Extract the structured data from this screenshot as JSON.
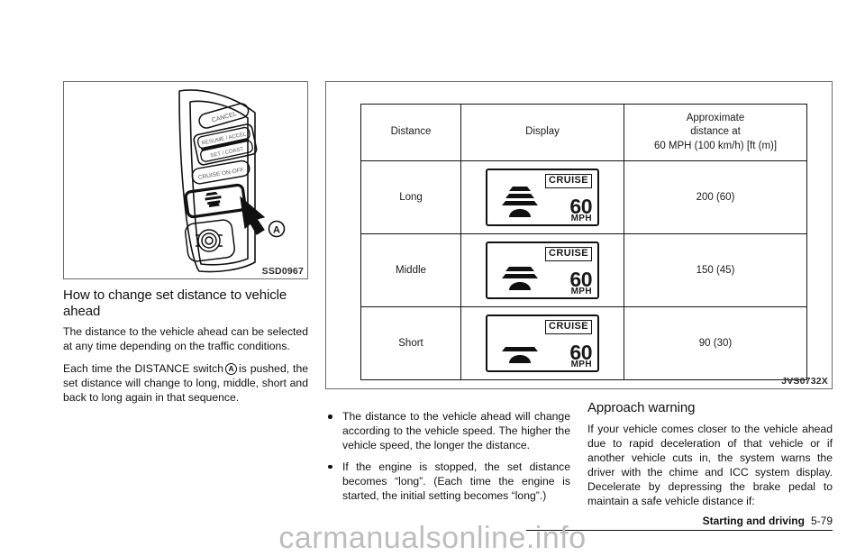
{
  "figure_left": {
    "caption": "SSD0967",
    "callout_label": "A",
    "switch_labels": [
      "CANCEL",
      "RESUME / ACCEL",
      "SET / COAST",
      "CRUISE ON-OFF"
    ]
  },
  "figure_right": {
    "caption": "JVS0732X",
    "table": {
      "headers": {
        "col1": "Distance",
        "col2": "Display",
        "col3_line1": "Approximate",
        "col3_line2": "distance at",
        "col3_line3": "60 MPH (100 km/h) [ft (m)]"
      },
      "rows": [
        {
          "distance": "Long",
          "bars": 3,
          "cruise": "CRUISE",
          "speed": "60",
          "unit": "MPH",
          "approx": "200 (60)"
        },
        {
          "distance": "Middle",
          "bars": 2,
          "cruise": "CRUISE",
          "speed": "60",
          "unit": "MPH",
          "approx": "150 (45)"
        },
        {
          "distance": "Short",
          "bars": 1,
          "cruise": "CRUISE",
          "speed": "60",
          "unit": "MPH",
          "approx": "90 (30)"
        }
      ]
    }
  },
  "section": {
    "heading": "How to change set distance to vehicle ahead",
    "para1": "The distance to the vehicle ahead can be selected at any time depending on the traffic conditions.",
    "para2_before": "Each time the DISTANCE switch",
    "para2_marker": "A",
    "para2_after": "is pushed, the set distance will change to long, middle, short and back to long again in that sequence."
  },
  "bullets": [
    "The distance to the vehicle ahead will change according to the vehicle speed. The higher the vehicle speed, the longer the distance.",
    "If the engine is stopped, the set distance becomes “long”. (Each time the engine is started, the initial setting becomes “long”.)"
  ],
  "approach": {
    "heading": "Approach warning",
    "para": "If your vehicle comes closer to the vehicle ahead due to rapid deceleration of that vehicle or if another vehicle cuts in, the system warns the driver with the chime and ICC system display. Decelerate by depressing the brake pedal to maintain a safe vehicle distance if:"
  },
  "footer": {
    "section_title": "Starting and driving",
    "page_number": "5-79",
    "watermark": "carmanualsonline.info"
  }
}
